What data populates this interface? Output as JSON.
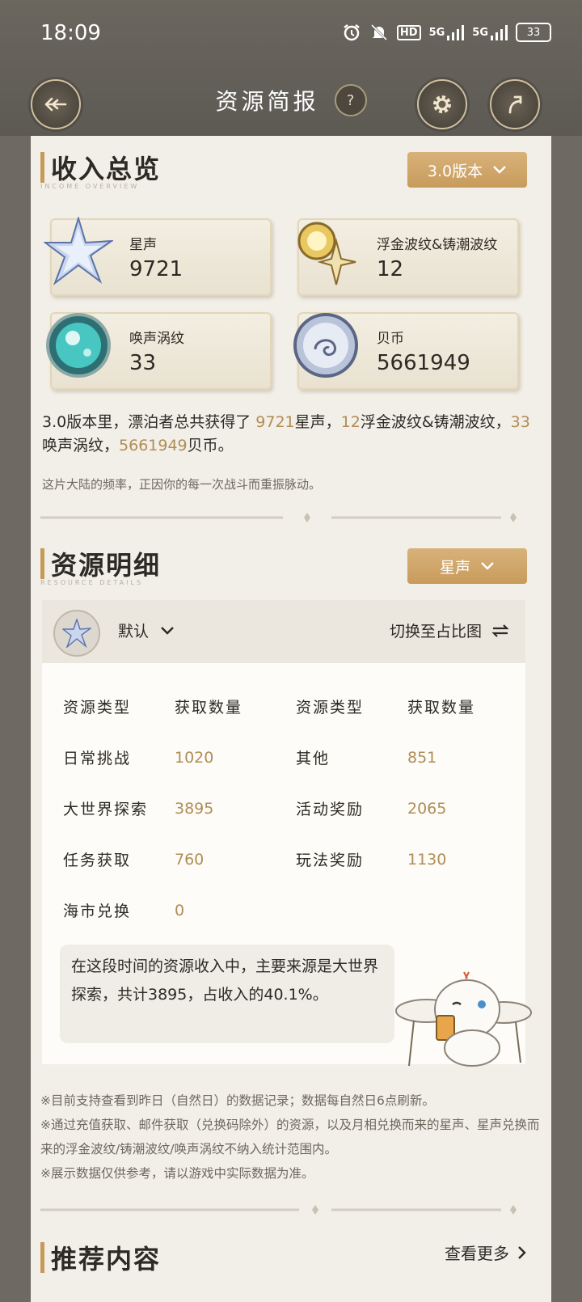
{
  "status_bar": {
    "time": "18:09",
    "icons": [
      "alarm-icon",
      "mute-icon",
      "hd-icon",
      "5g-signal-icon",
      "5g-signal-icon",
      "battery-icon"
    ],
    "hd_label": "HD",
    "signal_label_1": "5G",
    "signal_label_2": "5G",
    "battery": "33"
  },
  "header": {
    "title": "资源简报",
    "help": "?"
  },
  "income": {
    "title": "收入总览",
    "subtitle": "INCOME OVERVIEW",
    "version_select": "3.0版本",
    "resources": [
      {
        "name": "星声",
        "value": "9721",
        "icon": "astrite-icon"
      },
      {
        "name": "浮金波纹&铸潮波纹",
        "value": "12",
        "icon": "lustrous-tide-icon"
      },
      {
        "name": "唤声涡纹",
        "value": "33",
        "icon": "radiant-tide-icon"
      },
      {
        "name": "贝币",
        "value": "5661949",
        "icon": "shell-credit-icon"
      }
    ],
    "summary": {
      "prefix": "3.0版本里，漂泊者总共获得了 ",
      "v1": "9721",
      "t1": "星声，",
      "v2": "12",
      "t2": "浮金波纹&铸潮波纹，",
      "v3": "33",
      "t3": "唤声涡纹，",
      "v4": "5661949",
      "t4": "贝币。"
    },
    "motto": "这片大陆的频率，正因你的每一次战斗而重振脉动。"
  },
  "detail": {
    "title": "资源明细",
    "subtitle": "RESOURCE DETAILS",
    "resource_select": "星声",
    "sort_select": "默认",
    "switch_label": "切换至占比图",
    "table_headers": [
      "资源类型",
      "获取数量",
      "资源类型",
      "获取数量"
    ],
    "rows": [
      [
        "日常挑战",
        "1020",
        "其他",
        "851"
      ],
      [
        "大世界探索",
        "3895",
        "活动奖励",
        "2065"
      ],
      [
        "任务获取",
        "760",
        "玩法奖励",
        "1130"
      ],
      [
        "海市兑换",
        "0",
        "",
        ""
      ]
    ],
    "note": "在这段时间的资源收入中，主要来源是大世界探索，共计3895，占收入的40.1%。"
  },
  "footnotes": [
    "※目前支持查看到昨日（自然日）的数据记录；数据每自然日6点刷新。",
    "※通过充值获取、邮件获取（兑换码除外）的资源，以及月相兑换而来的星声、星声兑换而来的浮金波纹/铸潮波纹/唤声涡纹不纳入统计范围内。",
    "※展示数据仅供参考，请以游戏中实际数据为准。"
  ],
  "recommend": {
    "title": "推荐内容",
    "more": "查看更多"
  },
  "colors": {
    "accent_gold": "#c59b5a",
    "highlight_text": "#b08d55",
    "topbar": "#5d5a54",
    "card_bg": "#f2efe8"
  }
}
